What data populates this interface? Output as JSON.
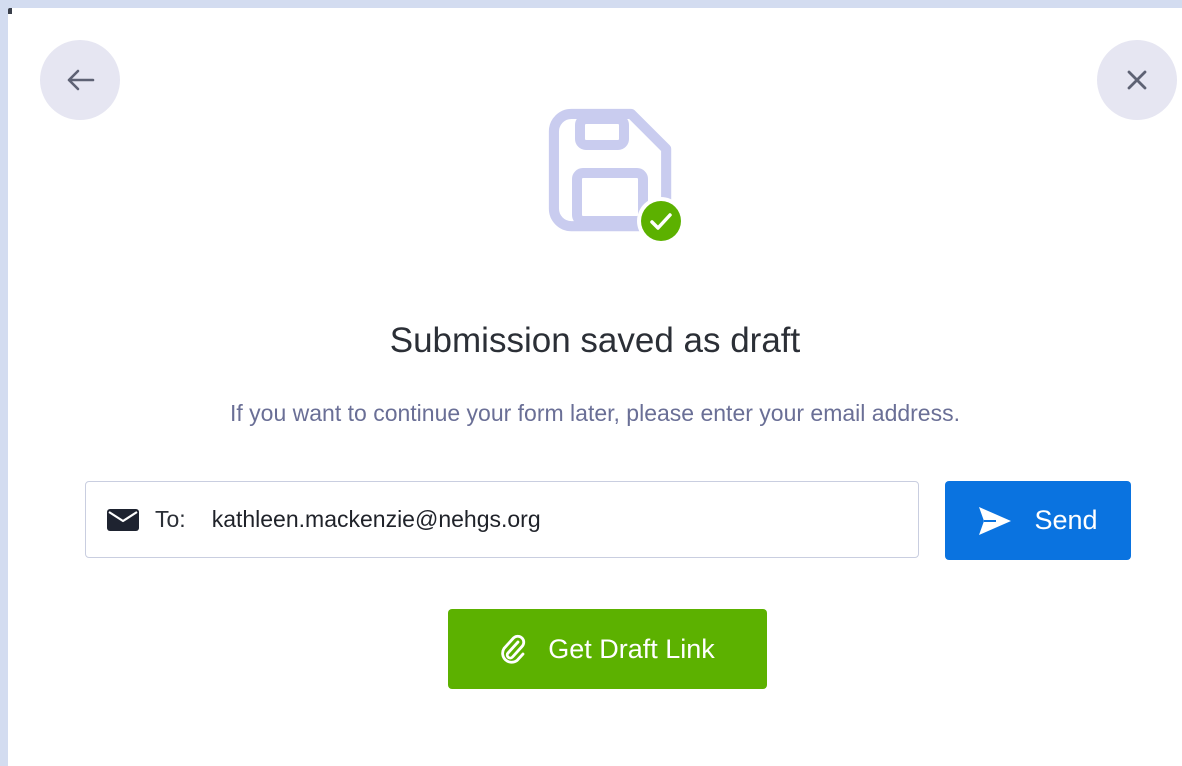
{
  "dialog": {
    "title": "Submission saved as draft",
    "subtitle": "If you want to continue your form later, please enter your email address."
  },
  "email": {
    "to_label": "To:",
    "value": "kathleen.mackenzie@nehgs.org"
  },
  "buttons": {
    "send_label": "Send",
    "draft_link_label": "Get Draft Link"
  },
  "icons": {
    "back": "arrow-left-icon",
    "close": "close-icon",
    "illustration": "floppy-disk-check-icon",
    "mail": "envelope-icon",
    "send": "paper-plane-icon",
    "draft_link": "paperclip-icon"
  },
  "colors": {
    "send_button": "#0a73e0",
    "draft_button": "#5cb100",
    "check_badge": "#5cb100",
    "illustration": "#c9ccef",
    "title_text": "#2b2f36",
    "subtitle_text": "#6a6f96",
    "page_background": "#d3dcf0"
  }
}
